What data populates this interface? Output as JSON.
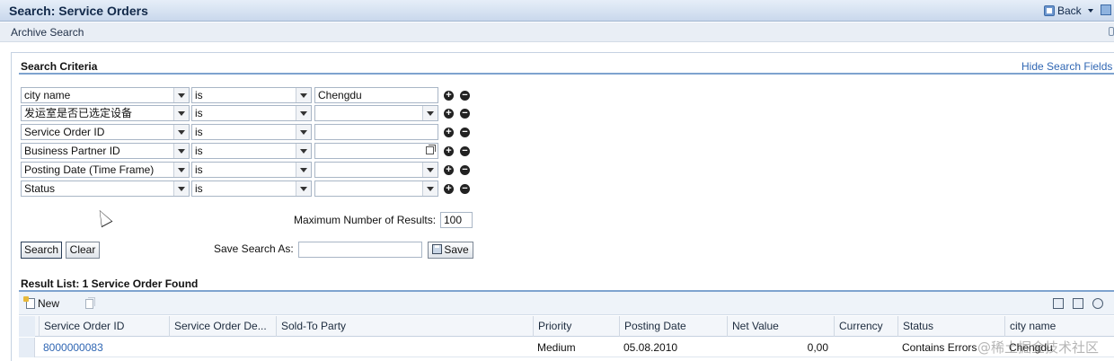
{
  "header": {
    "title": "Search: Service Orders",
    "back_label": "Back"
  },
  "subbar": {
    "label": "Archive Search"
  },
  "criteria": {
    "title": "Search Criteria",
    "hide_link": "Hide Search Fields",
    "rows": [
      {
        "field": "city name",
        "operator": "is",
        "value": "Chengdu"
      },
      {
        "field": "发运室是否已选定设备",
        "operator": "is",
        "value": ""
      },
      {
        "field": "Service Order ID",
        "operator": "is",
        "value": ""
      },
      {
        "field": "Business Partner ID",
        "operator": "is",
        "value": ""
      },
      {
        "field": "Posting Date (Time Frame)",
        "operator": "is",
        "value": ""
      },
      {
        "field": "Status",
        "operator": "is",
        "value": ""
      }
    ],
    "max_results_label": "Maximum Number of Results:",
    "max_results_value": "100",
    "search_button": "Search",
    "clear_button": "Clear",
    "save_search_label": "Save Search As:",
    "save_search_value": "",
    "save_button": "Save"
  },
  "results": {
    "title": "Result List: 1 Service Order Found",
    "new_button": "New",
    "columns": [
      "Service Order ID",
      "Service Order De...",
      "Sold-To Party",
      "Priority",
      "Posting Date",
      "Net Value",
      "Currency",
      "Status",
      "city name"
    ],
    "rows": [
      {
        "id": "8000000083",
        "description": "",
        "sold_to": "",
        "priority": "Medium",
        "posting_date": "05.08.2010",
        "net_value": "0,00",
        "currency": "",
        "status": "Contains Errors",
        "city": "Chengdu"
      }
    ]
  },
  "overlay": {
    "watermark": "@稀土掘金技术社区"
  },
  "icons": [
    "back-icon",
    "maximize-icon",
    "add-icon",
    "remove-icon",
    "value-help-icon",
    "save-icon",
    "new-icon",
    "copy-icon",
    "export-icon",
    "settings-icon",
    "print-icon",
    "mouse-cursor-icon"
  ]
}
